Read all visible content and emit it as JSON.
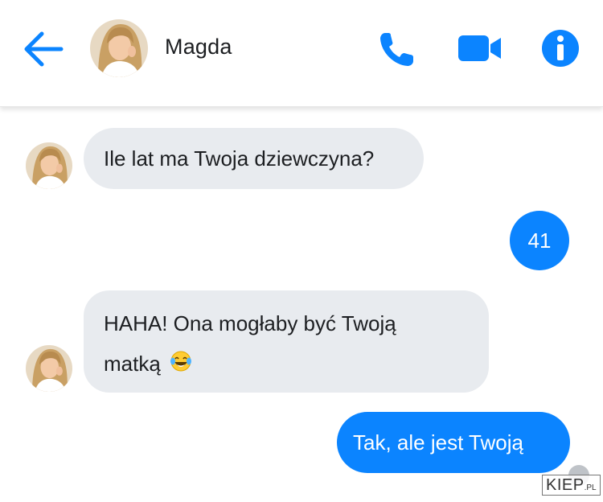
{
  "header": {
    "contact_name": "Magda",
    "accent_color": "#0b84ff",
    "icons": [
      "back-arrow-icon",
      "phone-icon",
      "video-camera-icon",
      "info-icon"
    ]
  },
  "messages": [
    {
      "direction": "incoming",
      "text": "Ile lat ma Twoja dziewczyna?"
    },
    {
      "direction": "outgoing",
      "text": "41"
    },
    {
      "direction": "incoming",
      "line1": "HAHA! Ona mogłaby być Twoją",
      "line2": "matką",
      "emoji": "face-with-tears-of-joy"
    },
    {
      "direction": "outgoing",
      "text": "Tak, ale jest Twoją"
    }
  ],
  "colors": {
    "incoming_bubble": "#e8ebef",
    "outgoing_bubble": "#0b84ff"
  },
  "watermark": {
    "main": "KIEP",
    "suffix": ".PL"
  }
}
